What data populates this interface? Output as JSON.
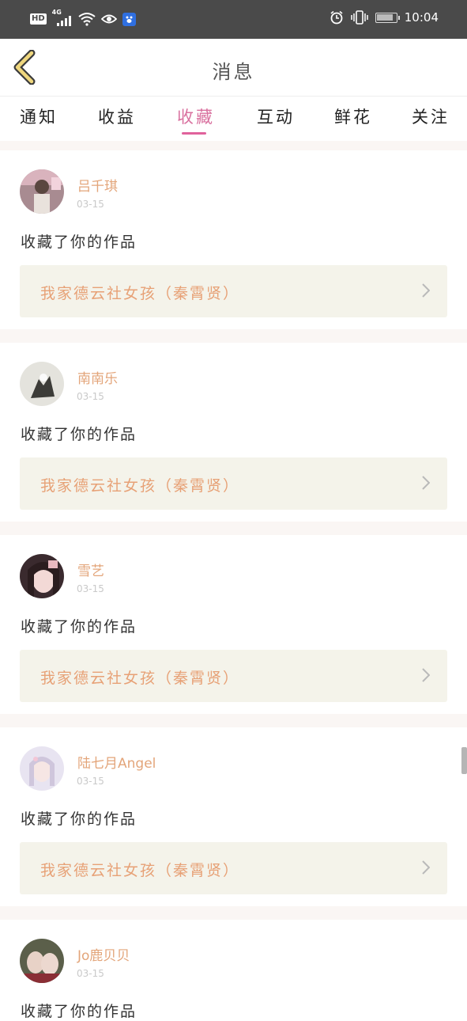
{
  "status_bar": {
    "hd": "HD",
    "network": "4G",
    "time": "10:04",
    "icons": [
      "signal-icon",
      "wifi-icon",
      "eye-icon",
      "baidu-icon",
      "alarm-icon",
      "vibrate-icon",
      "battery-icon"
    ]
  },
  "header": {
    "title": "消息",
    "back_icon": "back-arrow-icon"
  },
  "tabs": [
    {
      "label": "通知"
    },
    {
      "label": "收益"
    },
    {
      "label": "收藏"
    },
    {
      "label": "互动"
    },
    {
      "label": "鲜花"
    },
    {
      "label": "关注"
    }
  ],
  "active_tab": "收藏",
  "messages": [
    {
      "user": "吕千琪",
      "date": "03-15",
      "action": "收藏了你的作品",
      "work": "我家德云社女孩（秦霄贤）"
    },
    {
      "user": "南南乐",
      "date": "03-15",
      "action": "收藏了你的作品",
      "work": "我家德云社女孩（秦霄贤）"
    },
    {
      "user": "雪艺",
      "date": "03-15",
      "action": "收藏了你的作品",
      "work": "我家德云社女孩（秦霄贤）"
    },
    {
      "user": "陆七月Angel",
      "date": "03-15",
      "action": "收藏了你的作品",
      "work": "我家德云社女孩（秦霄贤）"
    },
    {
      "user": "Jo鹿贝贝",
      "date": "03-15",
      "action": "收藏了你的作品"
    }
  ],
  "colors": {
    "status_bar": "#4a4a4a",
    "accent_pink": "#e0629c",
    "username_orange": "#e3a57a",
    "work_box_bg": "#f4f3ea",
    "back_arrow": "#efd77e"
  }
}
